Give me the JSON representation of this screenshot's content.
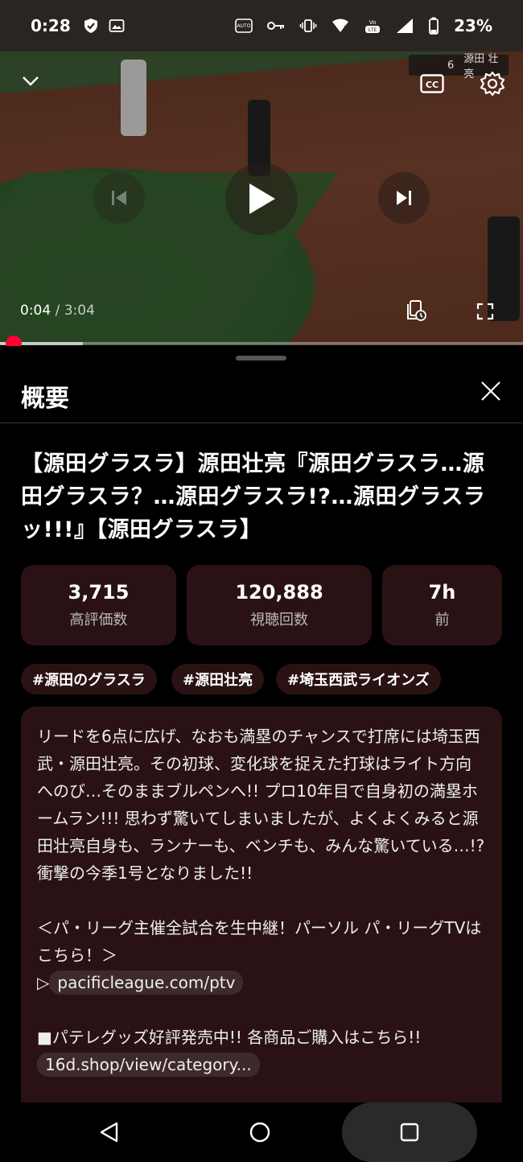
{
  "status_bar": {
    "time": "0:28",
    "battery": "23%",
    "icons": [
      "shield-check-icon",
      "image-icon",
      "auto-hz-icon",
      "key-icon",
      "vibrate-icon",
      "wifi-icon",
      "volte-icon",
      "signal-icon",
      "battery-icon"
    ]
  },
  "player": {
    "current_time": "0:04",
    "separator": " / ",
    "duration": "3:04",
    "progress_fraction": 0.022,
    "scorebug": {
      "number": "6",
      "name": "源田 壮亮"
    },
    "controls": [
      "collapse-icon",
      "captions-icon",
      "settings-icon",
      "previous-icon",
      "play-icon",
      "next-icon",
      "queue-clock-icon",
      "fullscreen-icon"
    ]
  },
  "sheet": {
    "title": "概要",
    "video_title": "【源田グラスラ】源田壮亮『源田グラスラ…源田グラスラ？…源田グラスラ!?…源田グラスラッ!!!』【源田グラスラ】",
    "stats": [
      {
        "value": "3,715",
        "label": "高評価数"
      },
      {
        "value": "120,888",
        "label": "視聴回数"
      },
      {
        "value": "7h",
        "label": "前"
      }
    ],
    "tags": [
      "#源田のグラスラ",
      "#源田壮亮",
      "#埼玉西武ライオンズ"
    ],
    "description": {
      "para1": "リードを6点に広げ、なおも満塁のチャンスで打席には埼玉西武・源田壮亮。その初球、変化球を捉えた打球はライト方向へのび…そのままブルペンへ!! プロ10年目で自身初の満塁ホームラン!!! 思わず驚いてしまいましたが、よくよくみると源田壮亮自身も、ランナーも、ベンチも、みんな驚いている…!? 衝撃の今季1号となりました!!",
      "para2": "＜パ・リーグ主催全試合を生中継！パーソル パ・リーグTVはこちら！＞",
      "link1_prefix": "▷",
      "link1": "pacificleague.com/ptv",
      "para3": "■パテレグッズ好評発売中!! 各商品ご購入はこちら!!",
      "link2": "16d.shop/view/category..."
    }
  },
  "nav": {
    "buttons": [
      "back-icon",
      "home-icon",
      "recents-icon"
    ]
  },
  "colors": {
    "accent": "#ff0033",
    "card": "#2a1214",
    "background": "#000000"
  }
}
